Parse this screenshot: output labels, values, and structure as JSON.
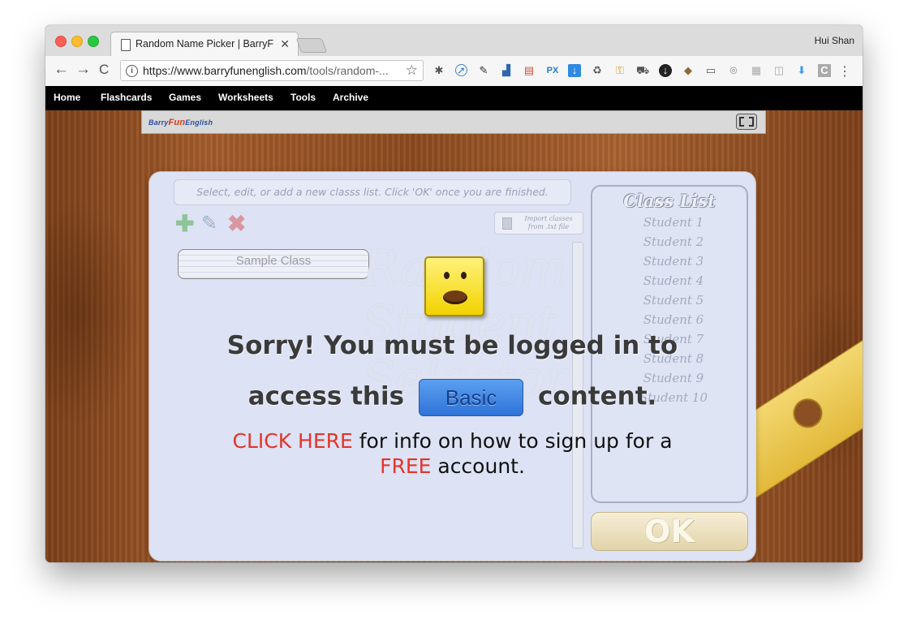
{
  "browser": {
    "tab_title": "Random Name Picker | BarryFu",
    "tab_close": "✕",
    "profile_name": "Hui Shan",
    "url_main": "https://www.barryfunenglish.com",
    "url_path": "/tools/random-...",
    "nav": {
      "back": "←",
      "forward": "→",
      "reload": "C"
    },
    "extensions": [
      "ext-bug-icon",
      "ext-compass-icon",
      "ext-dropper-icon",
      "ext-scanner-icon",
      "ext-page-icon",
      "ext-px-icon",
      "ext-download-icon",
      "ext-recycle-icon",
      "ext-key-icon",
      "ext-car-icon",
      "ext-arrow-icon",
      "ext-stamp-icon",
      "ext-window-icon",
      "ext-stack-icon",
      "ext-grid-icon",
      "ext-rss-icon",
      "ext-download2-icon",
      "ext-c-icon"
    ],
    "ext_px_label": "PX",
    "ext_c_label": "C",
    "menu_icon": "⋮"
  },
  "sitenav": {
    "items": [
      {
        "label": "Home"
      },
      {
        "label": "Flashcards"
      },
      {
        "label": "Games"
      },
      {
        "label": "Worksheets"
      },
      {
        "label": "Tools"
      },
      {
        "label": "Archive"
      }
    ]
  },
  "app": {
    "logo": {
      "left": "Barry",
      "mid": "Fun",
      "right": "English"
    },
    "hint": "Select, edit, or add a new classs list. Click 'OK' once you are finished.",
    "tools": {
      "add": "✚",
      "edit": "✎",
      "delete": "✖"
    },
    "import_label": "Import classes from .txt file",
    "class_item": "Sample Class",
    "watermark_lines": [
      "Random",
      "Student",
      "Selector"
    ],
    "class_list_title": "Class List",
    "students": [
      "Student 1",
      "Student 2",
      "Student 3",
      "Student 4",
      "Student 5",
      "Student 6",
      "Student 7",
      "Student 8",
      "Student 9",
      "Student 10"
    ],
    "ok_label": "OK"
  },
  "overlay": {
    "line1": "Sorry! You must be logged in to",
    "line2_pre": "access this",
    "badge": "Basic",
    "line2_post": "content.",
    "click_here": "CLICK HERE",
    "signup_mid": " for info on how to sign up for a",
    "free": "FREE",
    "signup_end": " account."
  },
  "colors": {
    "accent_red": "#e4352a",
    "badge_blue": "#3a7fe0",
    "nav_bg": "#000000"
  }
}
